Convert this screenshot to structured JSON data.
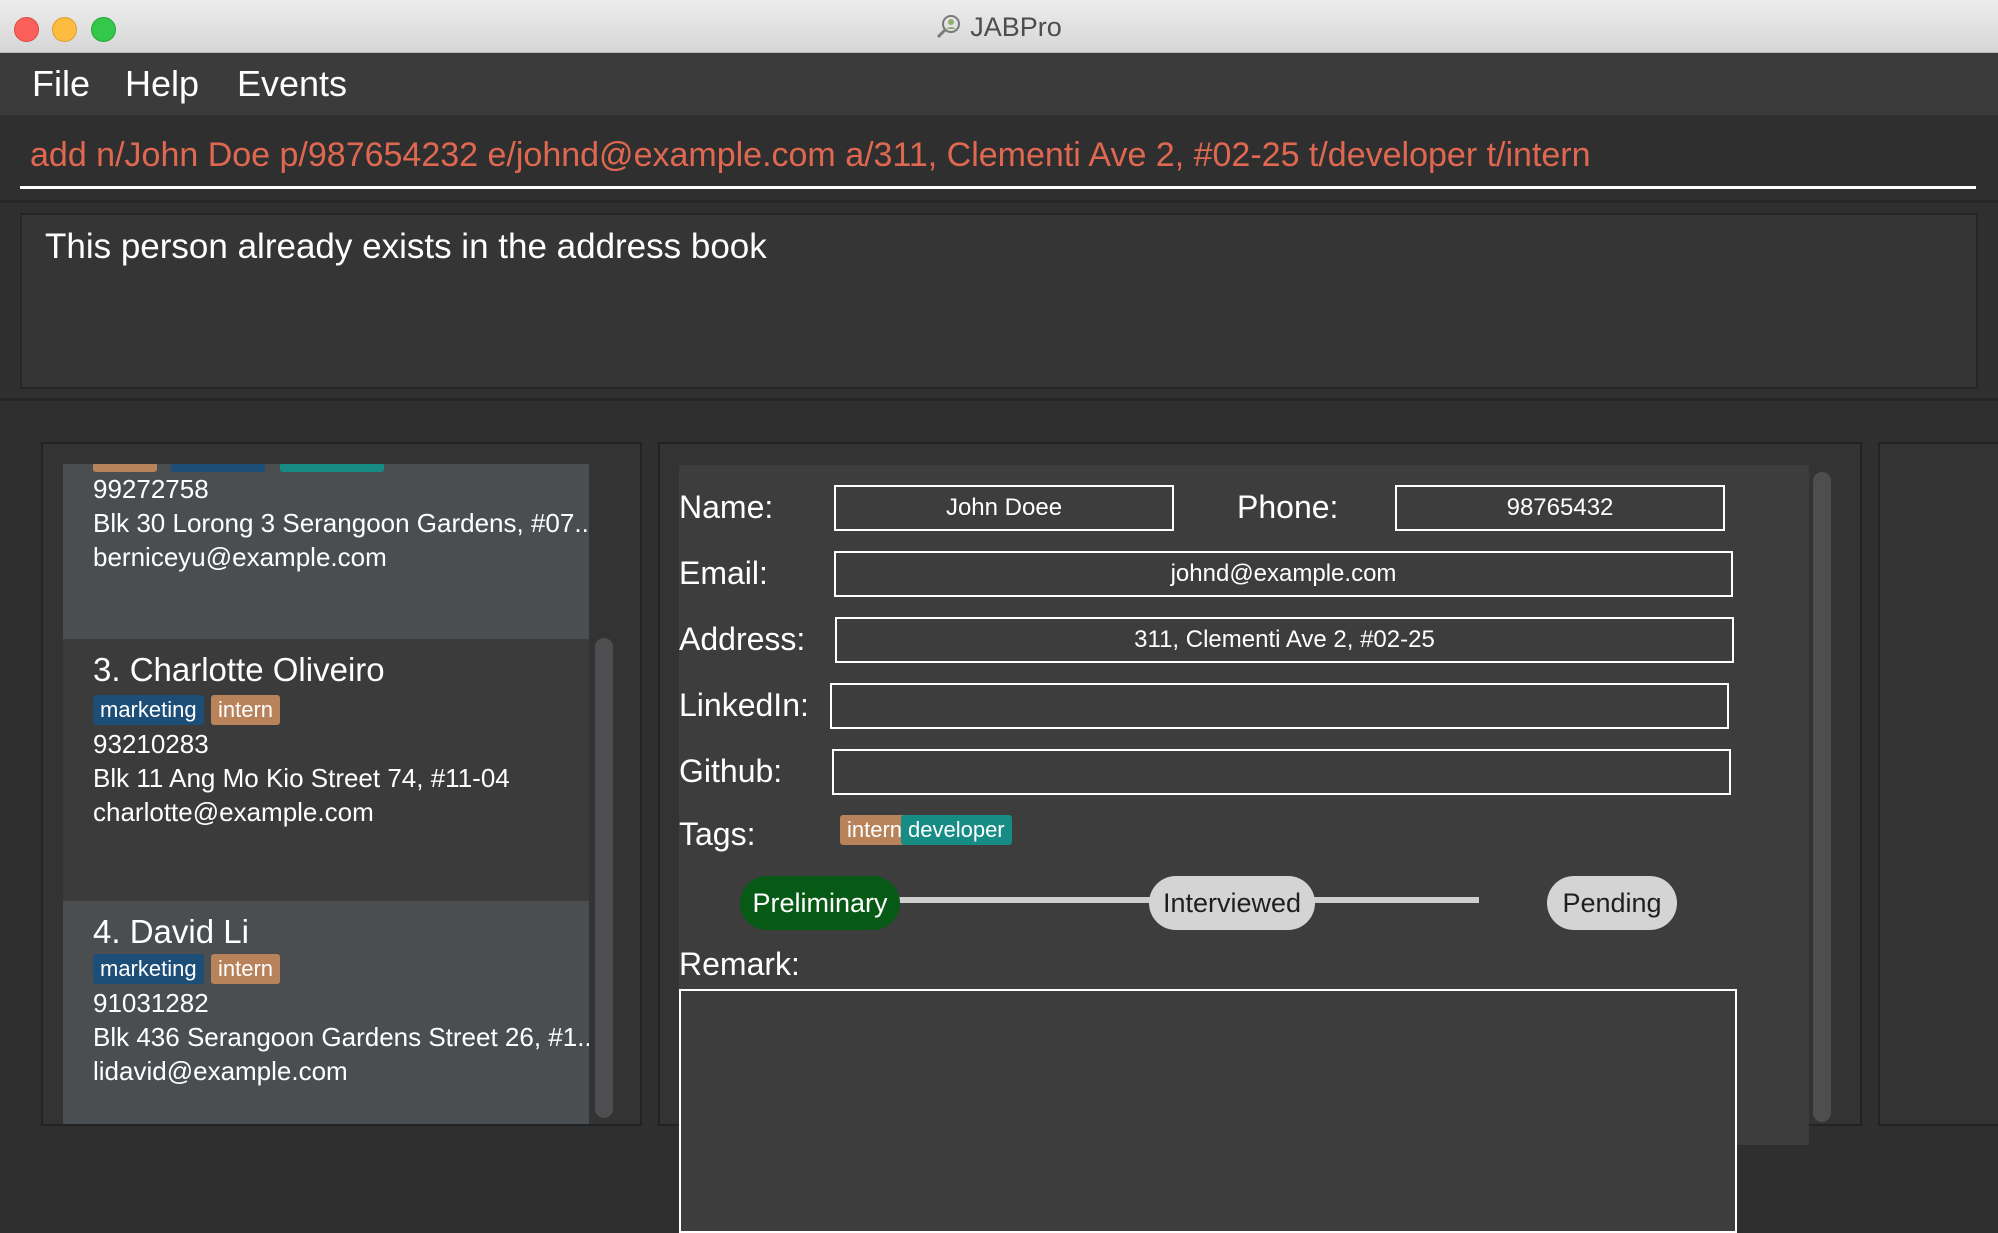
{
  "window": {
    "title": "JABPro"
  },
  "menu": [
    "File",
    "Help",
    "Events"
  ],
  "command": {
    "text": "add n/John Doe p/987654232 e/johnd@example.com a/311, Clementi Ave 2, #02-25 t/developer t/intern"
  },
  "result": {
    "message": "This person already exists in the address book"
  },
  "persons": [
    {
      "title": "",
      "phone": "99272758",
      "address": "Blk 30 Lorong 3 Serangoon Gardens, #07...",
      "email": "berniceyu@example.com"
    },
    {
      "title": "3.  Charlotte Oliveiro",
      "tags": [
        "marketing",
        "intern"
      ],
      "phone": "93210283",
      "address": "Blk 11 Ang Mo Kio Street 74, #11-04",
      "email": "charlotte@example.com"
    },
    {
      "title": "4.  David Li",
      "tags": [
        "marketing",
        "intern"
      ],
      "phone": "91031282",
      "address": "Blk 436 Serangoon Gardens Street 26, #1...",
      "email": "lidavid@example.com"
    }
  ],
  "details": {
    "labels": {
      "name": "Name:",
      "phone": "Phone:",
      "email": "Email:",
      "address": "Address:",
      "linkedin": "LinkedIn:",
      "github": "Github:",
      "tags": "Tags:",
      "remark": "Remark:"
    },
    "name": "John Doee",
    "phone": "98765432",
    "email": "johnd@example.com",
    "address": "311, Clementi Ave 2, #02-25",
    "linkedin": "",
    "github": "",
    "tags": [
      "intern",
      "developer"
    ],
    "stages": [
      "Preliminary",
      "Interviewed",
      "Pending"
    ],
    "current_stage": "Preliminary",
    "remark": ""
  },
  "colors": {
    "command_text": "#e06850",
    "tag_marketing": "#1d4e78",
    "tag_intern": "#b8835a",
    "tag_developer": "#168c85",
    "stage_active": "#075a16"
  }
}
